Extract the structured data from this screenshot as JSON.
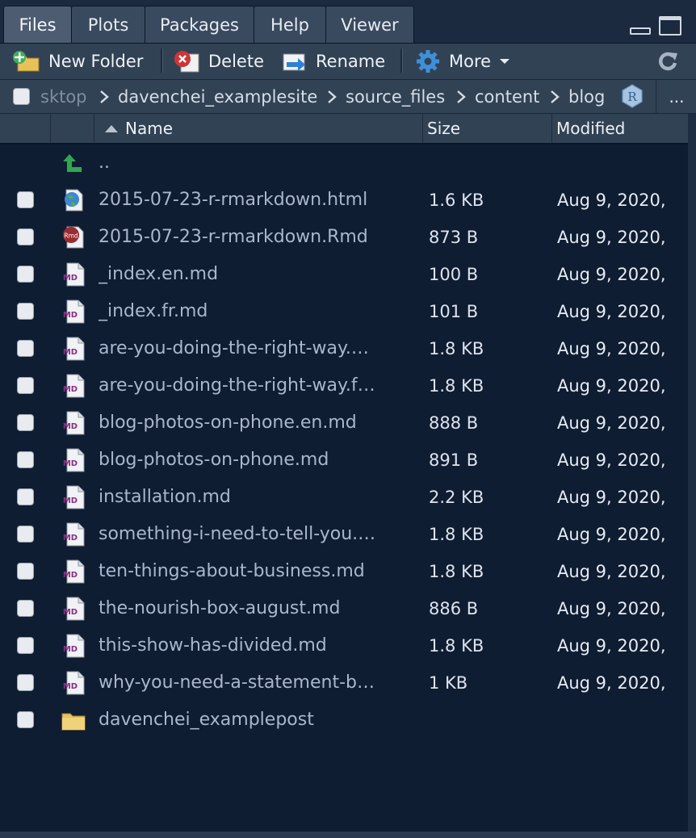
{
  "tabs": [
    {
      "label": "Files",
      "active": true
    },
    {
      "label": "Plots",
      "active": false
    },
    {
      "label": "Packages",
      "active": false
    },
    {
      "label": "Help",
      "active": false
    },
    {
      "label": "Viewer",
      "active": false
    }
  ],
  "toolbar": {
    "new_folder": "New Folder",
    "delete": "Delete",
    "rename": "Rename",
    "more": "More"
  },
  "path": {
    "segments": [
      "sktop",
      "davenchei_examplesite",
      "source_files",
      "content",
      "blog"
    ],
    "overflow": "..."
  },
  "columns": {
    "name": "Name",
    "size": "Size",
    "modified": "Modified"
  },
  "parent_dir": "..",
  "files": [
    {
      "name": "2015-07-23-r-rmarkdown.html",
      "size": "1.6 KB",
      "modified": "Aug 9, 2020,",
      "icon": "html-globe-icon"
    },
    {
      "name": "2015-07-23-r-rmarkdown.Rmd",
      "size": "873 B",
      "modified": "Aug 9, 2020,",
      "icon": "rmd-file-icon"
    },
    {
      "name": "_index.en.md",
      "size": "100 B",
      "modified": "Aug 9, 2020,",
      "icon": "md-file-icon"
    },
    {
      "name": "_index.fr.md",
      "size": "101 B",
      "modified": "Aug 9, 2020,",
      "icon": "md-file-icon"
    },
    {
      "name": "are-you-doing-the-right-way.…",
      "size": "1.8 KB",
      "modified": "Aug 9, 2020,",
      "icon": "md-file-icon"
    },
    {
      "name": "are-you-doing-the-right-way.f…",
      "size": "1.8 KB",
      "modified": "Aug 9, 2020,",
      "icon": "md-file-icon"
    },
    {
      "name": "blog-photos-on-phone.en.md",
      "size": "888 B",
      "modified": "Aug 9, 2020,",
      "icon": "md-file-icon"
    },
    {
      "name": "blog-photos-on-phone.md",
      "size": "891 B",
      "modified": "Aug 9, 2020,",
      "icon": "md-file-icon"
    },
    {
      "name": "installation.md",
      "size": "2.2 KB",
      "modified": "Aug 9, 2020,",
      "icon": "md-file-icon"
    },
    {
      "name": "something-i-need-to-tell-you.…",
      "size": "1.8 KB",
      "modified": "Aug 9, 2020,",
      "icon": "md-file-icon"
    },
    {
      "name": "ten-things-about-business.md",
      "size": "1.8 KB",
      "modified": "Aug 9, 2020,",
      "icon": "md-file-icon"
    },
    {
      "name": "the-nourish-box-august.md",
      "size": "886 B",
      "modified": "Aug 9, 2020,",
      "icon": "md-file-icon"
    },
    {
      "name": "this-show-has-divided.md",
      "size": "1.8 KB",
      "modified": "Aug 9, 2020,",
      "icon": "md-file-icon"
    },
    {
      "name": "why-you-need-a-statement-b…",
      "size": "1 KB",
      "modified": "Aug 9, 2020,",
      "icon": "md-file-icon"
    },
    {
      "name": "davenchei_examplepost",
      "size": "",
      "modified": "",
      "icon": "folder-icon"
    }
  ],
  "colors": {
    "background": "#0f1d33",
    "toolbar": "#324255",
    "filename": "#a9b6cc"
  }
}
